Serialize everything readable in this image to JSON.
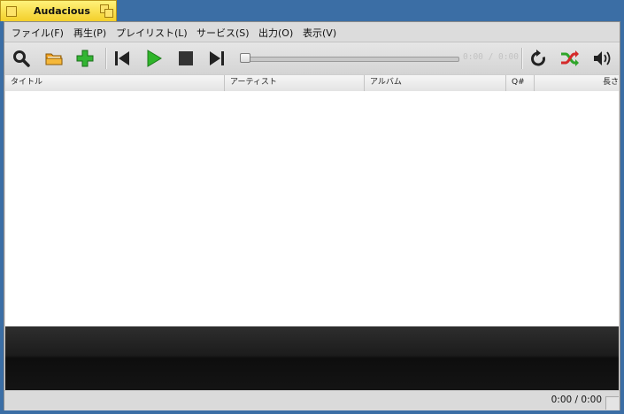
{
  "window": {
    "title": "Audacious"
  },
  "menu": [
    {
      "label": "ファイル(F)"
    },
    {
      "label": "再生(P)"
    },
    {
      "label": "プレイリスト(L)"
    },
    {
      "label": "サービス(S)"
    },
    {
      "label": "出力(O)"
    },
    {
      "label": "表示(V)"
    }
  ],
  "toolbar": {
    "time_display": "0:00 / 0:00",
    "seek_progress": 0,
    "icons": [
      "search-icon",
      "open-folder-icon",
      "add-icon",
      "previous-icon",
      "play-icon",
      "stop-icon",
      "next-icon",
      "repeat-icon",
      "shuffle-icon",
      "volume-icon"
    ]
  },
  "columns": [
    {
      "label": "タイトル"
    },
    {
      "label": "アーティスト"
    },
    {
      "label": "アルバム"
    },
    {
      "label": "Q#"
    },
    {
      "label": "長さ"
    }
  ],
  "status": {
    "time": "0:00 / 0:00"
  },
  "colors": {
    "title_tab": "#f3cf2a",
    "desktop": "#3b6ea5",
    "play_green": "#2fb52a",
    "add_green": "#33b533"
  }
}
